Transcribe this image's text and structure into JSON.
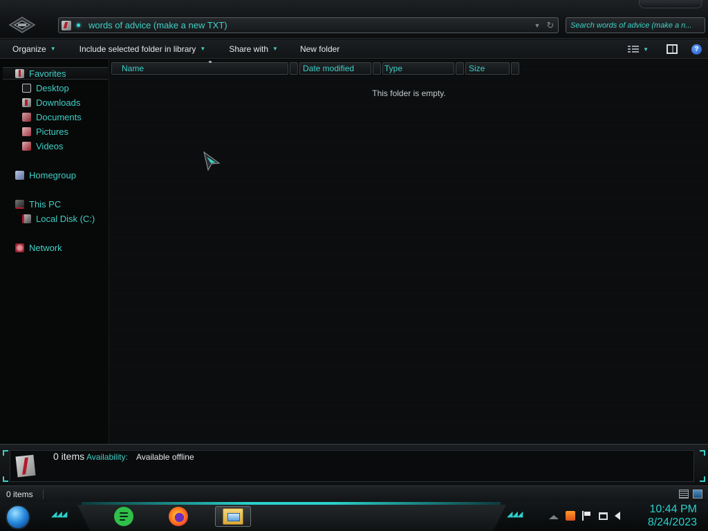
{
  "window": {
    "address_path": "words of advice (make a new TXT)",
    "search_placeholder": "Search words of advice (make a n..."
  },
  "toolbar": {
    "organize": "Organize",
    "include_library": "Include selected folder in library",
    "share_with": "Share with",
    "new_folder": "New folder"
  },
  "sidebar": {
    "favorites": "Favorites",
    "desktop": "Desktop",
    "downloads": "Downloads",
    "documents": "Documents",
    "pictures": "Pictures",
    "videos": "Videos",
    "homegroup": "Homegroup",
    "this_pc": "This PC",
    "local_disk": "Local Disk (C:)",
    "network": "Network"
  },
  "columns": [
    "Name",
    "Date modified",
    "Type",
    "Size"
  ],
  "content": {
    "empty_message": "This folder is empty."
  },
  "details": {
    "item_count": "0 items",
    "availability_label": "Availability:",
    "availability_value": "Available offline"
  },
  "status": {
    "item_count": "0 items"
  },
  "taskbar": {
    "time": "10:44 PM",
    "date": "8/24/2023",
    "pinned": [
      "notes-app",
      "firefox",
      "file-explorer"
    ]
  },
  "colors": {
    "accent_cyan": "#3fd1c7",
    "background": "#07090a",
    "panel": "#121517"
  },
  "icons": {
    "nav": "nav-orb-icon",
    "refresh": "refresh-icon",
    "help": "help-icon",
    "start": "start-orb-icon"
  }
}
